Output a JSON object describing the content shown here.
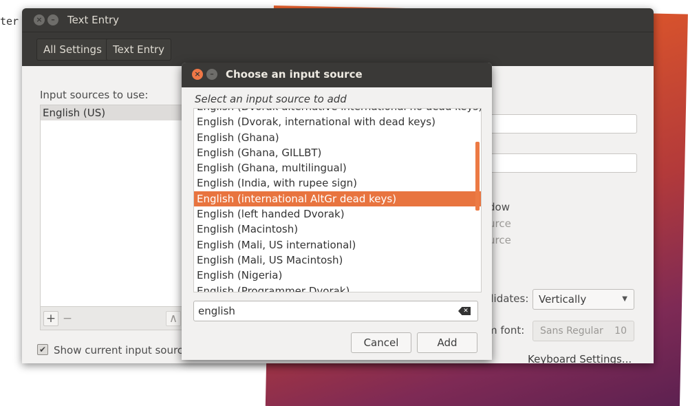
{
  "terminal_fragment": "ter",
  "main_window": {
    "title": "Text Entry",
    "nav": {
      "all_settings": "All Settings",
      "current": "Text Entry"
    },
    "input_sources_label": "Input sources to use:",
    "input_sources": [
      "English (US)"
    ],
    "toolbar": {
      "add": "+",
      "remove": "−",
      "up": "∧",
      "down": "∨"
    },
    "show_current_label": "Show current input source",
    "show_current_checked": true,
    "right_panel": {
      "line_window": "dow",
      "line_source1": "urce",
      "line_source2": "urce",
      "candidates_label": "didates:",
      "candidates_value": "Vertically",
      "font_label": "m font:",
      "font_value": "Sans Regular",
      "font_size": "10",
      "keyboard_settings": "Keyboard Settings..."
    }
  },
  "dialog": {
    "title": "Choose an input source",
    "subtitle": "Select an input source to add",
    "items": [
      "English (Dvorak alternative international no dead keys)",
      "English (Dvorak, international with dead keys)",
      "English (Ghana)",
      "English (Ghana, GILLBT)",
      "English (Ghana, multilingual)",
      "English (India, with rupee sign)",
      "English (international AltGr dead keys)",
      "English (left handed Dvorak)",
      "English (Macintosh)",
      "English (Mali, US international)",
      "English (Mali, US Macintosh)",
      "English (Nigeria)",
      "English (Programmer Dvorak)"
    ],
    "selected_index": 6,
    "search_value": "english",
    "cancel_label": "Cancel",
    "add_label": "Add"
  },
  "colors": {
    "accent": "#e8743f",
    "titlebar": "#3a3937",
    "window_bg": "#f2f1f0"
  }
}
